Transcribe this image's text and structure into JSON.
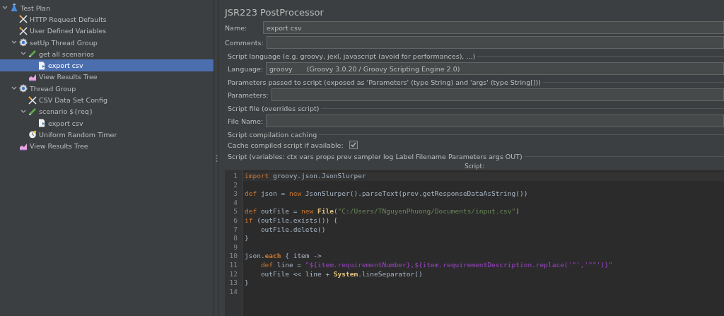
{
  "tree": [
    {
      "label": "Test Plan",
      "kind": "plan",
      "expanded": true,
      "selected": false,
      "children": [
        {
          "label": "HTTP Request Defaults",
          "kind": "config",
          "selected": false
        },
        {
          "label": "User Defined Variables",
          "kind": "config",
          "selected": false
        },
        {
          "label": "setUp Thread Group",
          "kind": "threads",
          "expanded": true,
          "selected": false,
          "children": [
            {
              "label": "get all scenarios",
              "kind": "sampler",
              "expanded": true,
              "selected": false,
              "children": [
                {
                  "label": "export csv",
                  "kind": "processor",
                  "selected": true
                }
              ]
            },
            {
              "label": "View Results Tree",
              "kind": "listener",
              "selected": false
            }
          ]
        },
        {
          "label": "Thread Group",
          "kind": "threads",
          "expanded": true,
          "selected": false,
          "children": [
            {
              "label": "CSV Data Set Config",
              "kind": "config",
              "selected": false
            },
            {
              "label": "scenario ${req}",
              "kind": "sampler",
              "expanded": true,
              "selected": false,
              "children": [
                {
                  "label": "export csv",
                  "kind": "processor",
                  "selected": false
                }
              ]
            },
            {
              "label": "Uniform Random Timer",
              "kind": "timer",
              "selected": false
            }
          ]
        },
        {
          "label": "View Results Tree",
          "kind": "listener",
          "selected": false
        }
      ]
    }
  ],
  "panel": {
    "title": "JSR223 PostProcessor",
    "name": {
      "label": "Name:",
      "value": "export csv"
    },
    "comments": {
      "label": "Comments:"
    },
    "language_section": "Script language (e.g. groovy, jexl, javascript (avoid for performances), ...)",
    "language": {
      "label": "Language:",
      "value": "groovy",
      "engine": "(Groovy 3.0.20 / Groovy Scripting Engine 2.0)"
    },
    "parameters_section": "Parameters passed to script (exposed as 'Parameters' (type String) and 'args' (type String[]))",
    "parameters": {
      "label": "Parameters:"
    },
    "file_section": "Script file (overrides script)",
    "file_name": {
      "label": "File Name:"
    },
    "caching_section": "Script compilation caching",
    "cache": {
      "label": "Cache compiled script if available:",
      "checked": true
    },
    "script_section": "Script (variables: ctx vars props prev sampler log Label Filename Parameters args OUT)",
    "script_label": "Script:",
    "code": [
      {
        "number": "1",
        "tokens": [
          {
            "kind": "kw",
            "text": "import"
          },
          {
            "kind": "plain",
            "text": " groovy.json.JsonSlurper"
          }
        ]
      },
      {
        "number": "2"
      },
      {
        "number": "3",
        "tokens": [
          {
            "kind": "kw",
            "text": "def"
          },
          {
            "kind": "plain",
            "text": " json = "
          },
          {
            "kind": "kw",
            "text": "new"
          },
          {
            "kind": "plain",
            "text": " JsonSlurper().parseText(prev.getResponseDataAsString())"
          }
        ]
      },
      {
        "number": "4"
      },
      {
        "number": "5",
        "tokens": [
          {
            "kind": "kw",
            "text": "def"
          },
          {
            "kind": "plain",
            "text": " outFile = "
          },
          {
            "kind": "kw",
            "text": "new"
          },
          {
            "kind": "type",
            "text": " File"
          },
          {
            "kind": "plain",
            "text": "("
          },
          {
            "kind": "str",
            "text": "\"C:/Users/TNguyenPhuong/Documents/input.csv\""
          },
          {
            "kind": "plain",
            "text": ")"
          }
        ]
      },
      {
        "number": "6",
        "tokens": [
          {
            "kind": "kw",
            "text": "if"
          },
          {
            "kind": "plain",
            "text": " (outFile.exists()) {"
          }
        ]
      },
      {
        "number": "7",
        "tokens": [
          {
            "kind": "plain",
            "text": "    outFile.delete()"
          }
        ]
      },
      {
        "number": "8",
        "tokens": [
          {
            "kind": "plain",
            "text": "}"
          }
        ]
      },
      {
        "number": "9"
      },
      {
        "number": "10",
        "tokens": [
          {
            "kind": "plain",
            "text": "json."
          },
          {
            "kind": "method",
            "text": "each"
          },
          {
            "kind": "plain",
            "text": " { item ->"
          }
        ]
      },
      {
        "number": "11",
        "tokens": [
          {
            "kind": "kw",
            "text": "    def"
          },
          {
            "kind": "plain",
            "text": " line = "
          },
          {
            "kind": "gstr",
            "text": "\"${item.requirementNumber},${item.requirementDescription.replace('\"','\"\"')}\""
          }
        ]
      },
      {
        "number": "12",
        "tokens": [
          {
            "kind": "plain",
            "text": "    outFile << line + "
          },
          {
            "kind": "type",
            "text": "System"
          },
          {
            "kind": "plain",
            "text": ".lineSeparator()"
          }
        ]
      },
      {
        "number": "13",
        "tokens": [
          {
            "kind": "plain",
            "text": "}"
          }
        ]
      },
      {
        "number": "14"
      }
    ]
  }
}
